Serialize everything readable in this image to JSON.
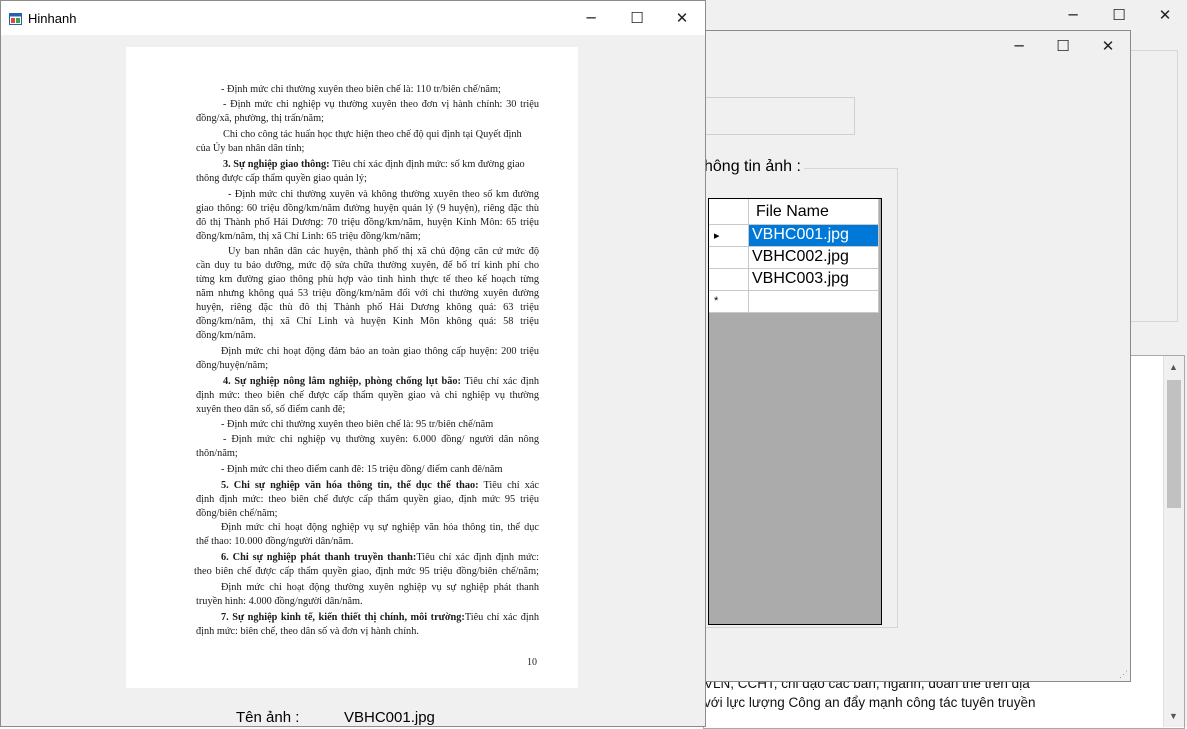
{
  "back_window": {
    "text_lines": [
      "VLN, CCHT; chỉ đạo các ban, ngành, đoàn thể trên địa",
      "với lực lượng Công an đẩy mạnh công tác tuyên truyền"
    ]
  },
  "mid_window": {
    "group_label": "hông tin ảnh :",
    "grid": {
      "header": "File Name",
      "rows": [
        "VBHC001.jpg",
        "VBHC002.jpg",
        "VBHC003.jpg"
      ],
      "new_row_marker": "*",
      "current_row_marker": "▸"
    }
  },
  "front_window": {
    "title": "Hinhanh",
    "caption_label": "Tên ảnh :",
    "caption_value": "VBHC001.jpg",
    "document": {
      "page_number": "10",
      "lines": [
        "- Định mức chi thường xuyên theo biên chế là: 110 tr/biên chế/năm;",
        "- Định mức chi nghiệp vụ thường xuyên theo đơn vị hành chính: 30 triệu",
        "đồng/xã, phường, thị trấn/năm;",
        "Chi cho công tác huấn học thực hiện theo chế độ qui định tại Quyết định",
        "của Ủy ban nhân dân tỉnh;",
        "3. Sự nghiệp giao thông: Tiêu chí xác định định mức: số km đường giao",
        "thông được cấp thẩm quyền giao quản lý;",
        "- Định mức chi thường xuyên và không thường xuyên theo số km đường",
        "giao thông: 60 triệu đồng/km/năm đường huyện quản lý (9 huyện), riêng đặc thù",
        "đô thị Thành phố Hải Dương: 70 triệu đồng/km/năm, huyện Kinh Môn: 65 triệu",
        "đồng/km/năm, thị xã Chí Linh: 65 triệu đồng/km/năm;",
        "Ủy ban nhân dân các huyện, thành phố thị xã chủ động căn cứ mức độ",
        "cần duy tu bảo dưỡng, mức độ sửa chữa thường xuyên, để bố trí kinh phí cho",
        "từng km đường giao thông phù hợp vào tình hình thực tế theo kế hoạch từng",
        "năm nhưng không quá 53 triệu đồng/km/năm đối với chi thường xuyên đường",
        "huyện, riêng đặc thù đô thị Thành phố Hải Dương không quá: 63 triệu",
        "đồng/km/năm, thị xã Chí Linh và huyện Kinh Môn không quá: 58 triệu",
        "đồng/km/năm.",
        "Định mức chi hoạt động đảm bảo an toàn giao thông cấp huyện: 200 triệu",
        "đồng/huyện/năm;",
        "4. Sự nghiệp nông lâm nghiệp, phòng chống lụt bão: Tiêu chí xác định",
        "định mức: theo biên chế được cấp thẩm quyền giao và chi nghiệp vụ thường",
        "xuyên theo dân số, số điểm canh đê;",
        "- Định mức chi thường xuyên theo biên chế là: 95 tr/biên chế/năm",
        "- Định mức chi nghiệp vụ thường xuyên: 6.000 đồng/ người dân nông",
        "thôn/năm;",
        "- Định mức chi theo điểm canh đê: 15 triệu đồng/ điểm canh đê/năm",
        "5. Chi sự nghiệp văn hóa thông tin, thể dục thể thao: Tiêu chí xác",
        "định định mức: theo biên chế được cấp thẩm quyền giao, định mức 95 triệu",
        "đồng/biên chế/năm;",
        "Định mức chi hoạt động nghiệp vụ sự nghiệp văn hóa thông tin, thể dục",
        "thể thao: 10.000 đồng/người dân/năm.",
        "6. Chi sự nghiệp phát thanh truyền thanh:Tiêu chí xác định định mức:",
        "theo biên chế được cấp thẩm quyền giao, định mức 95 triệu đồng/biên chế/năm;",
        "Định mức chi hoạt động thường xuyên nghiệp vụ sự nghiệp phát thanh",
        "truyền hình: 4.000 đồng/người dân/năm.",
        "7. Sự nghiệp kinh tế, kiến thiết thị chính, môi trường:Tiêu chí xác định",
        "định mức: biên chế, theo dân số và đơn vị hành chính."
      ]
    }
  },
  "icons": {
    "minimize": "minimize-icon",
    "maximize": "maximize-icon",
    "close": "close-icon",
    "app": "app-icon"
  },
  "colors": {
    "selection": "#0078d7",
    "grid_empty": "#ababab",
    "window_bg": "#f0f0f0"
  }
}
